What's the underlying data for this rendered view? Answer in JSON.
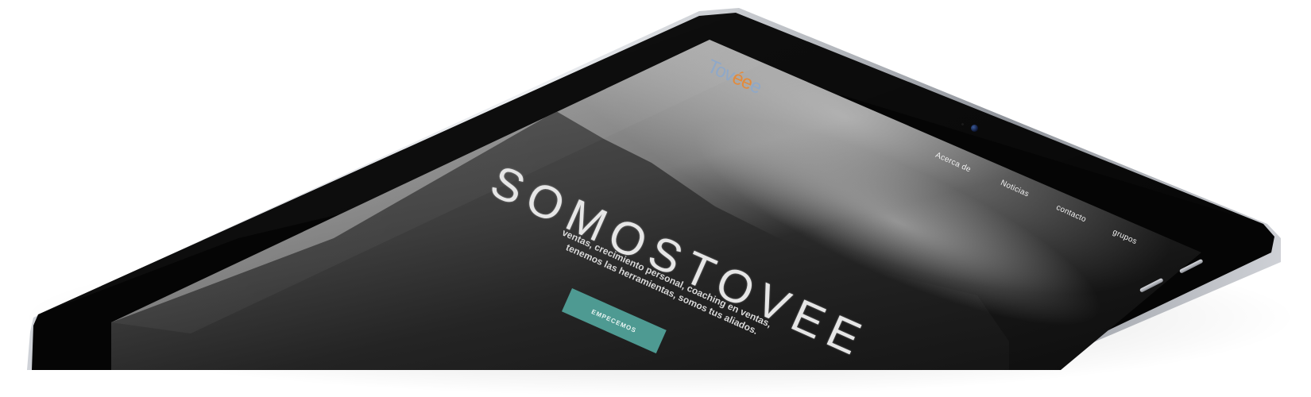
{
  "site": {
    "logo": {
      "text_main": "Tov",
      "text_accent": "ée",
      "text_tail": "e"
    },
    "nav": [
      {
        "label": "Acerca de"
      },
      {
        "label": "Noticias"
      },
      {
        "label": "contacto"
      },
      {
        "label": "grupos"
      }
    ],
    "hero": {
      "title": "SOMOSTOVEE",
      "subtitle": "ventas, crecimiento personal, coaching en ventas, tenemos las herramientas, somos tus aliados.",
      "cta_label": "EMPECEMOS"
    }
  },
  "colors": {
    "bezel": "#050505",
    "cta": "#4e9a92",
    "logo": "#8fa8c8",
    "logo_accent": "#e48a3a"
  },
  "device": {
    "type": "tablet"
  }
}
